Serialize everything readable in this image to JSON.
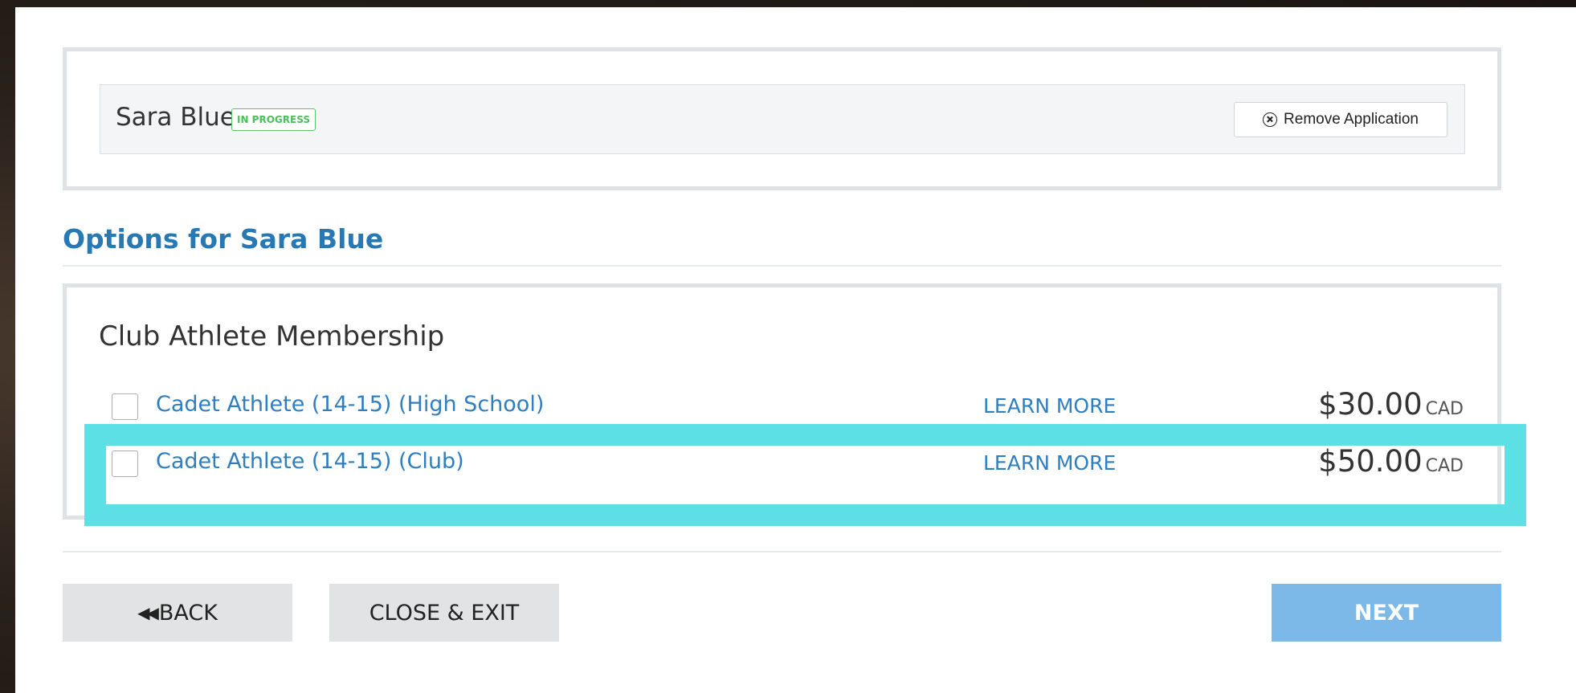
{
  "application": {
    "applicant_name": "Sara Blue",
    "status": "IN PROGRESS",
    "remove_label": "Remove Application"
  },
  "options_section": {
    "title": "Options for Sara Blue",
    "group_title": "Club Athlete Membership",
    "options": [
      {
        "label": "Cadet Athlete (14-15) (High School)",
        "learn_more": "LEARN MORE",
        "price": "$30.00",
        "currency": "CAD",
        "checked": false
      },
      {
        "label": "Cadet Athlete (14-15) (Club)",
        "learn_more": "LEARN MORE",
        "price": "$50.00",
        "currency": "CAD",
        "checked": false
      }
    ]
  },
  "footer": {
    "back_label": "BACK",
    "close_label": "CLOSE & EXIT",
    "next_label": "NEXT"
  },
  "colors": {
    "accent_blue": "#2878b4",
    "highlight": "#5ce0e6",
    "status_green": "#4cbf5a",
    "next_button": "#7db9e8"
  },
  "icons": {
    "remove": "circle-x-icon",
    "back": "double-chevron-left-icon",
    "pointer": "triangle-pointer-icon"
  }
}
